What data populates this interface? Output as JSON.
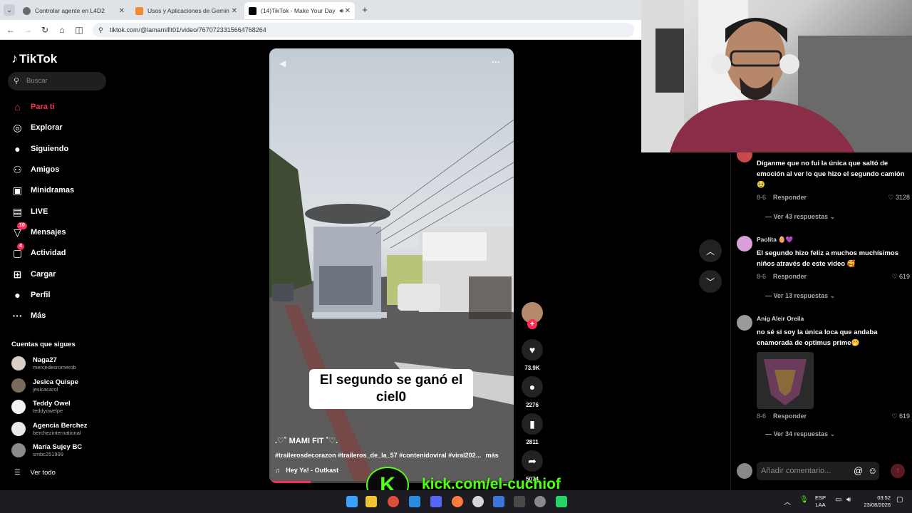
{
  "browser": {
    "tabs": [
      {
        "label": "Controlar agente en L4D2",
        "color": "#6b6b6b"
      },
      {
        "label": "Usos y Aplicaciones de Gemin",
        "color": "#4285f4"
      },
      {
        "label": "(14)TikTok - Make Your Day",
        "color": "#000000"
      }
    ],
    "url": "tiktok.com/@lamamifit01/video/7670723315664768264"
  },
  "tiktok": {
    "logo": "TikTok",
    "search_placeholder": "Buscar",
    "nav": [
      {
        "label": "Para ti",
        "icon": "home-icon",
        "glyph": "⌂",
        "active": true
      },
      {
        "label": "Explorar",
        "icon": "compass-icon",
        "glyph": "◎"
      },
      {
        "label": "Siguiendo",
        "icon": "following-avatar-icon",
        "glyph": "●"
      },
      {
        "label": "Amigos",
        "icon": "friends-icon",
        "glyph": "⚇"
      },
      {
        "label": "Minidramas",
        "icon": "minidramas-icon",
        "glyph": "▣"
      },
      {
        "label": "LIVE",
        "icon": "live-icon",
        "glyph": "▤"
      },
      {
        "label": "Mensajes",
        "icon": "messages-icon",
        "glyph": "▽",
        "badge": "10"
      },
      {
        "label": "Actividad",
        "icon": "activity-icon",
        "glyph": "▢",
        "badge": "4"
      },
      {
        "label": "Cargar",
        "icon": "upload-icon",
        "glyph": "⊞"
      },
      {
        "label": "Perfil",
        "icon": "profile-avatar-icon",
        "glyph": "●"
      },
      {
        "label": "Más",
        "icon": "more-dots-icon",
        "glyph": "···"
      }
    ],
    "following_title": "Cuentas que sigues",
    "following": [
      {
        "name": "Naga27",
        "handle": "mercedesromerob"
      },
      {
        "name": "Jesica Quispe",
        "handle": "jesicacarol"
      },
      {
        "name": "Teddy Owel",
        "handle": "teddyowelpe"
      },
      {
        "name": "Agencia Berchez",
        "handle": "berchezinternational"
      },
      {
        "name": "María Sujey BC",
        "handle": "smbc251999"
      }
    ],
    "see_all": "Ver todo"
  },
  "video": {
    "overlay_line1": "El segundo se ganó el",
    "overlay_line2": "ciel0",
    "author": ".♡˚ MAMI FIT ˚♡.",
    "hashtags": "#trailerosdecorazon #traileros_de_la_57 #contenidoviral #viral202...",
    "more": "más",
    "music": "Hey Ya! - Outkast",
    "progress": 0.17
  },
  "actions": {
    "likes": "73.9K",
    "comments": "2276",
    "saves": "2811",
    "shares": "5074"
  },
  "comments": [
    {
      "user": "",
      "text": "Díganme que no fui la única que saltó de emoción al ver lo que hizo el segundo camión 🥹",
      "date": "8-6",
      "reply": "Responder",
      "likes": "3128",
      "more": "Ver 43 respuestas"
    },
    {
      "user": "Paolita 🥚💜",
      "text": "El segundo hizo feliz a muchos muchísimos niños através de este video 🥰",
      "date": "8-6",
      "reply": "Responder",
      "likes": "619",
      "more": "Ver 13 respuestas"
    },
    {
      "user": "Anig Aleir Oreila",
      "text": "no sé si soy la única loca que andaba enamorada de optimus prime🤭",
      "date": "8-6",
      "reply": "Responder",
      "likes": "619",
      "more": "Ver 34 respuestas"
    }
  ],
  "comment_input_placeholder": "Añadir comentario...",
  "overlay_link": "kick.com/el-cuchiof",
  "system": {
    "lang": "ESP",
    "lang2": "LAA",
    "time": "03:52",
    "date": "23/08/2026"
  },
  "colors": {
    "accent": "#fe2c55",
    "kick_green": "#53fc18"
  }
}
